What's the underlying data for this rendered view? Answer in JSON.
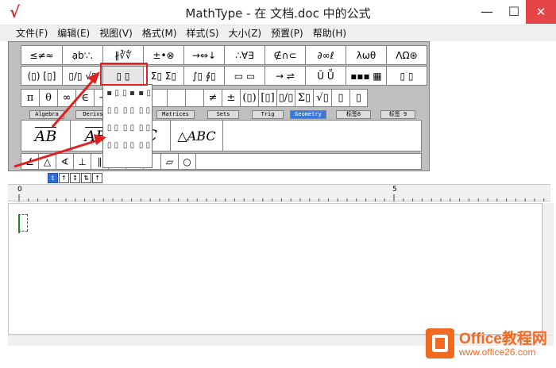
{
  "window": {
    "title": "MathType - 在 文档.doc 中的公式",
    "min_glyph": "—",
    "max_glyph": "☐",
    "close_glyph": "✕"
  },
  "menu": [
    "文件(F)",
    "编辑(E)",
    "视图(V)",
    "格式(M)",
    "样式(S)",
    "大小(Z)",
    "预置(P)",
    "帮助(H)"
  ],
  "symbol_row_1": [
    "≤≠≈",
    "ạb∵.",
    "∦∛∜",
    "±•⊗",
    "→⇔↓",
    "∴∀∃",
    "∉∩⊂",
    "∂∞ℓ",
    "λωθ",
    "ΛΩ⊛"
  ],
  "template_row_1": [
    "(▯) [▯]",
    "▯/▯ √▯",
    "▯ ▯",
    "Σ▯ Σ▯",
    "∫▯ ∮▯",
    "▭ ▭",
    "→ ⇌",
    "Ū Ṻ",
    "▪▪▪ ▦",
    "▯ ▯"
  ],
  "small_row": [
    "π",
    "θ",
    "∞",
    "∈",
    "→",
    "∂",
    "",
    "",
    "",
    "",
    "≠",
    "±",
    "(▯)",
    "[▯]",
    "▯/▯",
    "Σ▯",
    "√▯",
    "▯",
    "▯"
  ],
  "palette_tabs": [
    "Algebra",
    "Derivs",
    "",
    "Matrices",
    "Sets",
    "Trig",
    "Geometry",
    "标签8",
    "标签 9"
  ],
  "templates": [
    "AB",
    "AB",
    "BC",
    "△ABC"
  ],
  "geometry_row": [
    "∠",
    "△",
    "∢",
    "⊥",
    "∥",
    "",
    "",
    "",
    "",
    "",
    "",
    "▱",
    "○"
  ],
  "popup_items": [
    "▪ ▯",
    "▯ ▪",
    "▪ ▯",
    "▯ ▯",
    "▯ ▯",
    "▯ ▯",
    "▯ ▯",
    "▯ ▯",
    "▯ ▯",
    "▯ ▯",
    "▯ ▯",
    "▯ ▯"
  ],
  "style_buttons": [
    "t",
    "↑",
    "↕",
    "⇅",
    "↑"
  ],
  "ruler": {
    "mark_0": "0",
    "mark_5": "5"
  },
  "watermark": {
    "name": "Office教程网",
    "url": "www.office26.com"
  },
  "colors": {
    "highlight": "#e02020",
    "arrow": "#e02020",
    "active_tab": "#3a78d8",
    "close_button": "#e64545"
  }
}
